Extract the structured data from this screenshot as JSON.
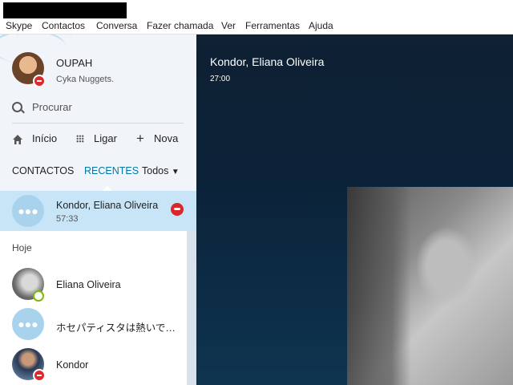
{
  "menu": [
    "Skype",
    "Contactos",
    "Conversa",
    "Fazer chamada",
    "Ver",
    "Ferramentas",
    "Ajuda"
  ],
  "profile": {
    "name": "OUPAH",
    "mood": "Cyka Nuggets."
  },
  "search": {
    "placeholder": "Procurar"
  },
  "actions": {
    "home": "Início",
    "call": "Ligar",
    "new": "Nova"
  },
  "tabs": {
    "contacts": "CONTACTOS",
    "recent": "RECENTES",
    "filter": "Todos"
  },
  "active_call": {
    "name": "Kondor, Eliana Oliveira",
    "duration": "57:33"
  },
  "recent": {
    "section": "Hoje",
    "items": [
      {
        "name": "Eliana Oliveira",
        "status": "online"
      },
      {
        "name": "ホセパティスタは熱いで…",
        "status": "group"
      },
      {
        "name": "Kondor",
        "status": "busy"
      }
    ]
  },
  "call": {
    "title": "Kondor, Eliana Oliveira",
    "time": "27:00"
  },
  "colors": {
    "accent": "#0078a8",
    "busy": "#e0292b",
    "online": "#7fba00",
    "call_bg": "#0e3450"
  }
}
